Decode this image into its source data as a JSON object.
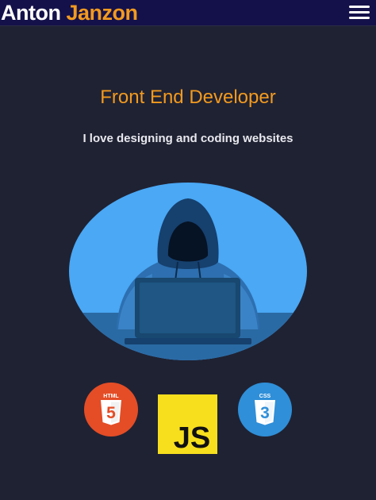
{
  "header": {
    "brand_first": "Anton",
    "brand_last": "Janzon",
    "menu_icon": "hamburger-menu-icon"
  },
  "hero": {
    "title": "Front End Developer",
    "subtitle": "I love designing and coding websites",
    "illustration": "hooded-developer-at-laptop"
  },
  "tech_logos": {
    "html": {
      "icon": "html5-icon",
      "label": "HTML",
      "badge": "5"
    },
    "js": {
      "icon": "javascript-icon",
      "label": "JS"
    },
    "css": {
      "icon": "css3-icon",
      "label": "CSS",
      "badge": "3"
    }
  },
  "colors": {
    "background": "#1f2233",
    "navbar": "#14114a",
    "accent": "#f39a1e",
    "html": "#e44d26",
    "js": "#f7df1e",
    "css": "#2f8fd8"
  }
}
